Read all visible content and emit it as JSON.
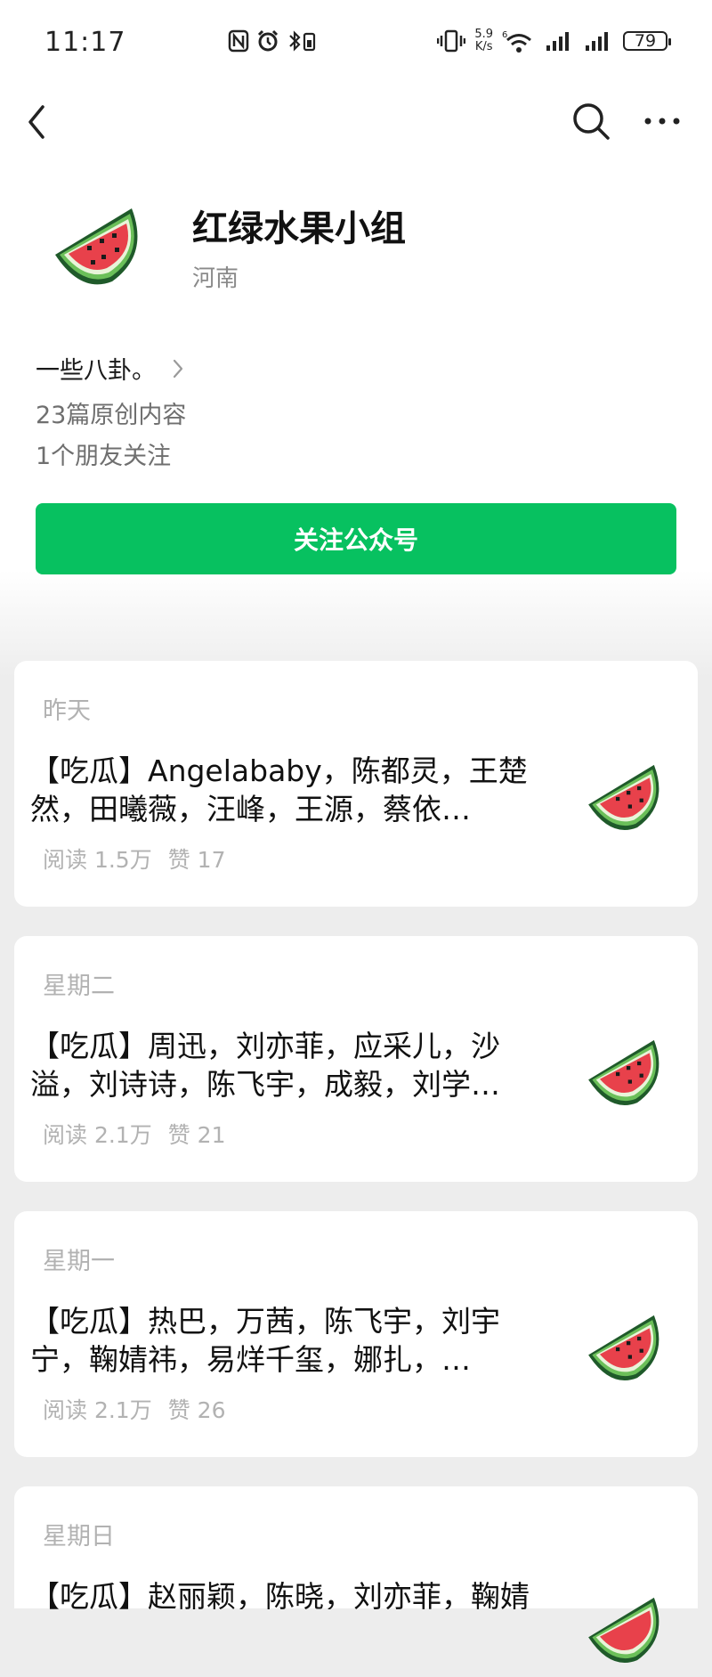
{
  "status_bar": {
    "time": "11:17",
    "net_speed_value": "5.9",
    "net_speed_unit": "K/s",
    "battery": "79"
  },
  "nav": {
    "back_icon": "chevron-left-icon",
    "search_icon": "search-icon",
    "more_icon": "more-horizontal-icon"
  },
  "profile": {
    "name": "红绿水果小组",
    "region": "河南",
    "intro": "一些八卦。",
    "original_count": "23篇原创内容",
    "friends_following": "1个朋友关注",
    "follow_button": "关注公众号"
  },
  "articles": [
    {
      "date": "昨天",
      "title": "【吃瓜】Angelababy，陈都灵，王楚然，田曦薇，汪峰，王源，蔡依…",
      "reads": "阅读 1.5万",
      "likes": "赞 17"
    },
    {
      "date": "星期二",
      "title": "【吃瓜】周迅，刘亦菲，应采儿，沙溢，刘诗诗，陈飞宇，成毅，刘学…",
      "reads": "阅读 2.1万",
      "likes": "赞 21"
    },
    {
      "date": "星期一",
      "title": "【吃瓜】热巴，万茜，陈飞宇，刘宇宁，鞠婧祎，易烊千玺，娜扎，…",
      "reads": "阅读 2.1万",
      "likes": "赞 26"
    },
    {
      "date": "星期日",
      "title": "【吃瓜】赵丽颖，陈晓，刘亦菲，鞠婧",
      "reads": "",
      "likes": ""
    }
  ],
  "colors": {
    "accent_green": "#07c160",
    "page_bg": "#ededed",
    "meta_gray": "#b2b2b2"
  }
}
